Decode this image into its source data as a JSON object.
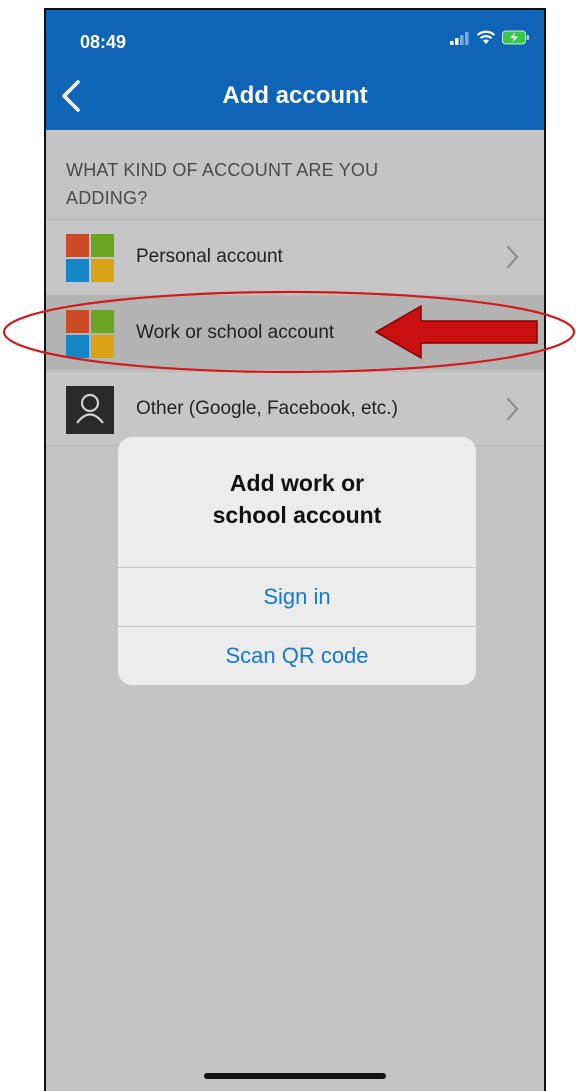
{
  "status_bar": {
    "time": "08:49"
  },
  "header": {
    "title": "Add account"
  },
  "section_header": "WHAT KIND OF ACCOUNT ARE YOU ADDING?",
  "accounts": [
    {
      "label": "Personal account",
      "icon": "microsoft-logo-icon"
    },
    {
      "label": "Work or school account",
      "icon": "microsoft-logo-icon",
      "highlighted": true
    },
    {
      "label": "Other (Google, Facebook, etc.)",
      "icon": "person-icon"
    }
  ],
  "dialog": {
    "title_line1": "Add work or",
    "title_line2": "school account",
    "sign_in_label": "Sign in",
    "scan_qr_label": "Scan QR code"
  },
  "colors": {
    "header_bg": "#0f64b7",
    "annotation_red": "#d11a1a",
    "link_blue": "#1479d1"
  }
}
